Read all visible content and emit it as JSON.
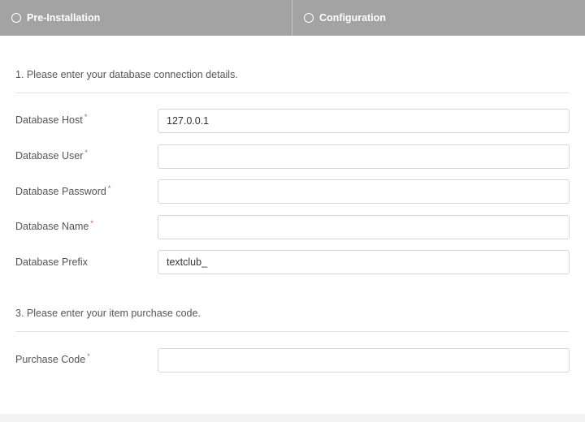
{
  "steps": [
    {
      "label": "Pre-Installation"
    },
    {
      "label": "Configuration"
    }
  ],
  "database_section": {
    "title": "1. Please enter your database connection details.",
    "fields": [
      {
        "label": "Database Host",
        "required": true,
        "value": "127.0.0.1"
      },
      {
        "label": "Database User",
        "required": true,
        "value": ""
      },
      {
        "label": "Database Password",
        "required": true,
        "value": ""
      },
      {
        "label": "Database Name",
        "required": true,
        "value": ""
      },
      {
        "label": "Database Prefix",
        "required": false,
        "value": "textclub_"
      }
    ]
  },
  "purchase_section": {
    "title": "3. Please enter your item purchase code.",
    "fields": [
      {
        "label": "Purchase Code",
        "required": true,
        "value": ""
      }
    ]
  },
  "required_marker": "*"
}
